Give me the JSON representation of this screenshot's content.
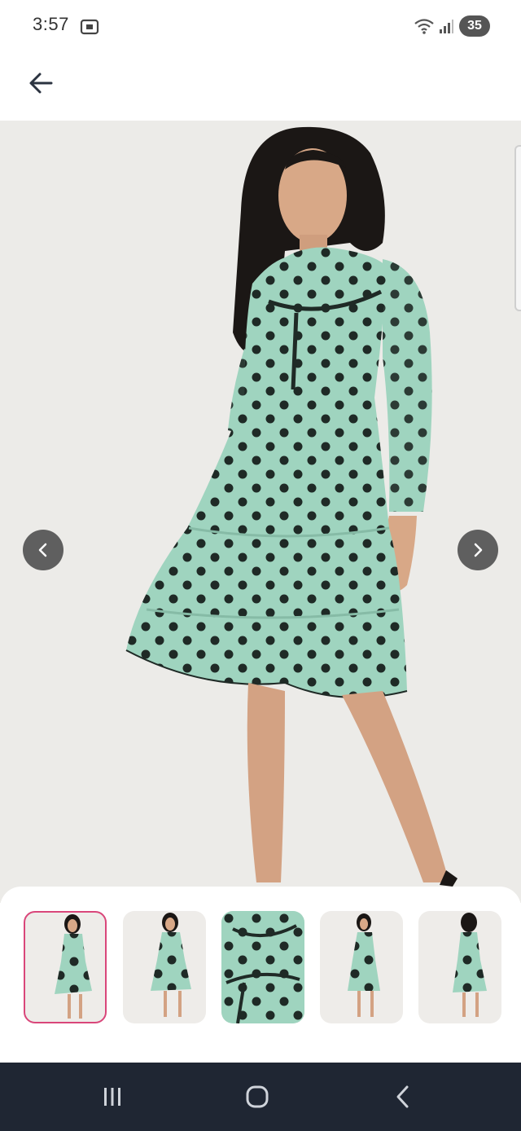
{
  "status_bar": {
    "time": "3:57",
    "battery": "35",
    "icons": [
      "screenshot-icon",
      "wifi-icon",
      "signal-icon"
    ]
  },
  "app_bar": {
    "back_icon": "arrow-left-icon"
  },
  "product": {
    "image_count": 5,
    "selected_index": 0,
    "dress_color": "#9fd4bf",
    "dot_color": "#1f2a26"
  },
  "carousel": {
    "prev_icon": "chevron-left-icon",
    "next_icon": "chevron-right-icon"
  },
  "thumbnails": [
    {
      "view": "front",
      "selected": true
    },
    {
      "view": "front",
      "selected": false
    },
    {
      "view": "detail",
      "selected": false
    },
    {
      "view": "side",
      "selected": false
    },
    {
      "view": "back",
      "selected": false
    }
  ],
  "colors": {
    "selected_border": "#d9467a",
    "system_nav_bg": "#1f2633"
  },
  "system_nav": {
    "icons": [
      "recents-icon",
      "home-icon",
      "back-icon"
    ]
  }
}
